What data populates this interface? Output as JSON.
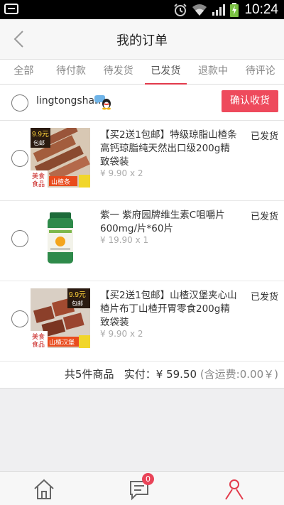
{
  "status_bar": {
    "time": "10:24"
  },
  "header": {
    "title": "我的订单"
  },
  "tabs": [
    {
      "label": "全部"
    },
    {
      "label": "待付款"
    },
    {
      "label": "待发货"
    },
    {
      "label": "已发货",
      "active": true
    },
    {
      "label": "退款中"
    },
    {
      "label": "待评论"
    }
  ],
  "order": {
    "shop_name": "lingtongshan",
    "confirm_label": "确认收货",
    "items": [
      {
        "title": "【买2送1包邮】特级琼脂山楂条高钙琼脂纯天然出口级200g精致袋装",
        "price": "¥ 9.90 x 2",
        "status": "已发货",
        "image_badge": "9.9元",
        "image_badge2": "包邮",
        "image_tag": "山楂条",
        "image_brand": "美食",
        "image_brand2": "食品"
      },
      {
        "title": "紫一 紫府园牌维生素C咀嚼片600mg/片*60片",
        "price": "¥ 19.90 x 1",
        "status": "已发货"
      },
      {
        "title": "【买2送1包邮】山楂汉堡夹心山楂片布丁山楂开胃零食200g精致袋装",
        "price": "¥ 9.90 x 2",
        "status": "已发货",
        "image_badge": "9.9元",
        "image_badge2": "包邮",
        "image_tag": "山楂汉堡",
        "image_brand": "美食",
        "image_brand2": "食品"
      }
    ],
    "summary": {
      "count_text": "共5件商品",
      "pay_label": "实付：",
      "total": "¥ 59.50",
      "shipping": "(含运费:0.00￥)"
    }
  },
  "bottom_nav": {
    "badge_count": "0",
    "icons": [
      "home-icon",
      "message-icon",
      "user-icon"
    ],
    "active_color": "#e23a4b"
  },
  "colors": {
    "accent": "#ee4a5c",
    "tab_underline": "#e23a4b"
  }
}
